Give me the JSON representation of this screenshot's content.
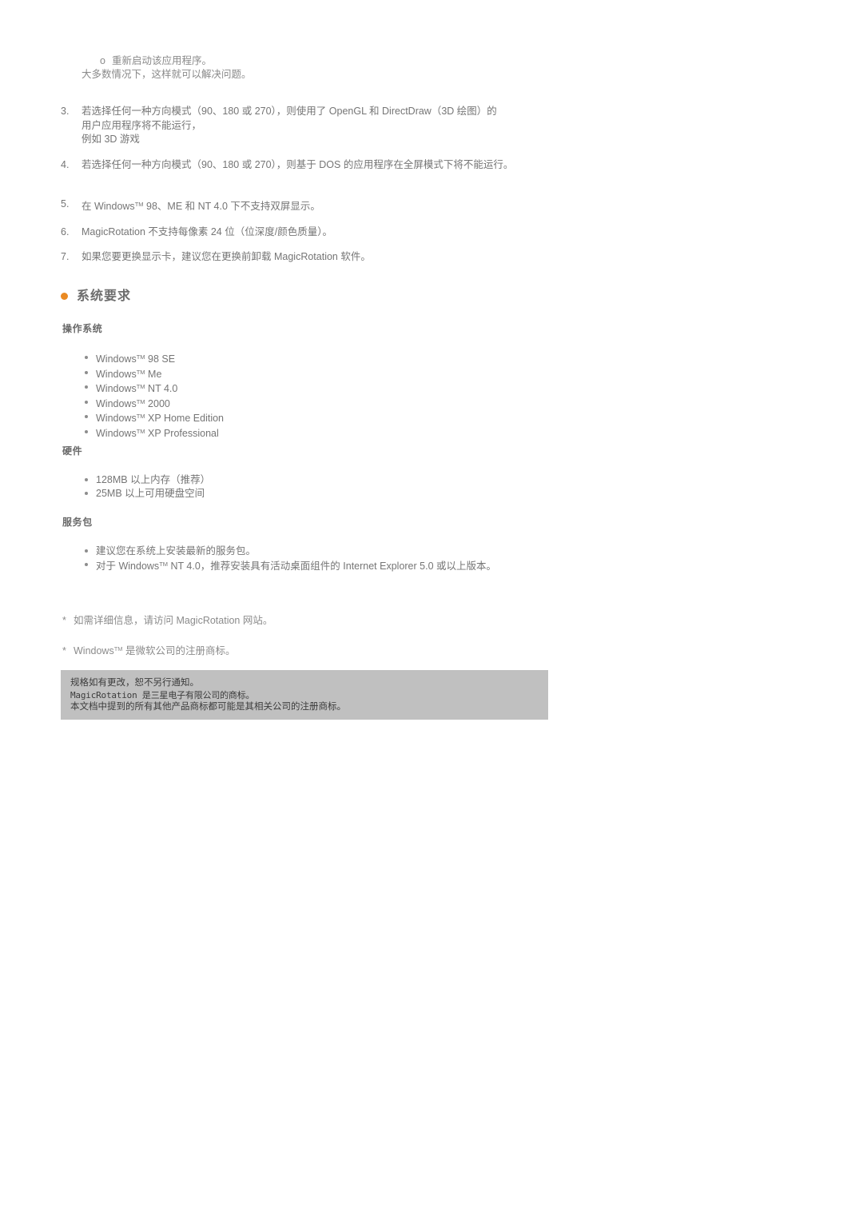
{
  "document": {
    "title": "MagicRotation - 系统要求"
  },
  "colors": {
    "accent_dot": "#ea8a22",
    "body_text": "#757575",
    "legal_box_background": "#c0c0c0",
    "legal_box_text": "#3b3b3b"
  },
  "notes_block": {
    "sub_bullet": {
      "marker": "o",
      "text": "重新启动该应用程序。"
    },
    "sub_followup": "大多数情况下，这样就可以解决问题。",
    "items": [
      {
        "number": "3.",
        "lines": [
          "若选择任何一种方向模式（90、180 或 270），则使用了 OpenGL 和 DirectDraw（3D 绘图）的",
          "用户应用程序将不能运行，",
          "例如 3D 游戏"
        ]
      },
      {
        "number": "4.",
        "lines": [
          "若选择任何一种方向模式（90、180 或 270），则基于 DOS 的应用程序在全屏模式下将不能运行。"
        ]
      },
      {
        "number": "5.",
        "lines": [
          "在 Windows™ 98、ME 和 NT 4.0 下不支持双屏显示。"
        ]
      },
      {
        "number": "6.",
        "lines": [
          "MagicRotation 不支持每像素 24 位（位深度/颜色质量）。"
        ]
      },
      {
        "number": "7.",
        "lines": [
          "如果您要更换显示卡，建议您在更换前卸载 MagicRotation 软件。"
        ]
      }
    ]
  },
  "system_requirements": {
    "heading": "系统要求",
    "os": {
      "label": "操作系统",
      "items": [
        "Windows™ 98 SE",
        "Windows™ Me",
        "Windows™ NT 4.0",
        "Windows™ 2000",
        "Windows™ XP Home Edition",
        "Windows™ XP Professional"
      ]
    },
    "hardware": {
      "label": "硬件",
      "items": [
        "128MB 以上内存（推荐）",
        "25MB 以上可用硬盘空间"
      ]
    },
    "service_pack": {
      "label": "服务包",
      "items": [
        "建议您在系统上安装最新的服务包。",
        "对于 Windows™ NT 4.0，推荐安装具有活动桌面组件的 Internet Explorer 5.0 或以上版本。"
      ]
    }
  },
  "footnotes": [
    {
      "marker": "*",
      "text": "如需详细信息，请访问 MagicRotation 网站。"
    },
    {
      "marker": "*",
      "text": "Windows™ 是微软公司的注册商标。"
    }
  ],
  "legal_box": {
    "lines": [
      "规格如有更改，恕不另行通知。",
      "MagicRotation 是三星电子有限公司的商标。",
      "本文档中提到的所有其他产品商标都可能是其相关公司的注册商标。"
    ]
  }
}
